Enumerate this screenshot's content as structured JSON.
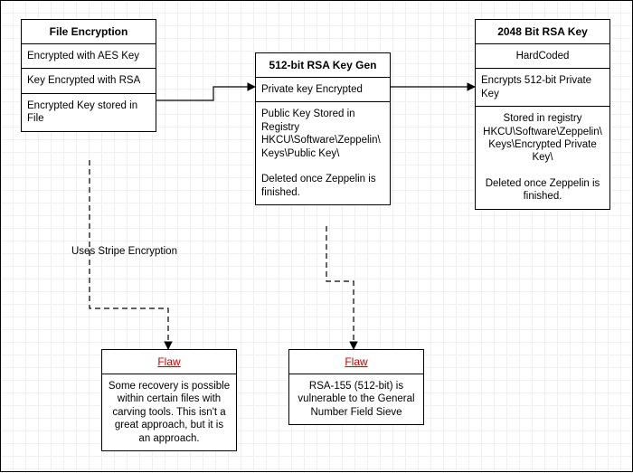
{
  "boxes": {
    "fileEnc": {
      "title": "File Encryption",
      "items": [
        "Encrypted with AES Key",
        "Key Encrypted with RSA",
        "Encrypted Key stored in File"
      ]
    },
    "rsa512": {
      "title": "512-bit RSA Key Gen",
      "items": [
        "Private key Encrypted",
        "Public Key Stored in Registry HKCU\\Software\\Zeppelin\\Keys\\Public Key\\\n\nDeleted once Zeppelin is finished."
      ]
    },
    "rsa2048": {
      "title": "2048 Bit RSA Key",
      "items": [
        "HardCoded",
        "Encrypts 512-bit Private Key",
        "Stored in registry HKCU\\Software\\Zeppelin\\Keys\\Encrypted Private Key\\\n\nDeleted once Zeppelin is finished."
      ]
    },
    "flaw1": {
      "title": "Flaw",
      "items": [
        "Some recovery is possible within certain files with carving tools. This isn't a great approach, but it is an approach."
      ]
    },
    "flaw2": {
      "title": "Flaw",
      "items": [
        "RSA-155 (512-bit) is vulnerable to the General Number Field Sieve"
      ]
    }
  },
  "edge_labels": {
    "stripe": "Uses Stripe Encryption"
  }
}
